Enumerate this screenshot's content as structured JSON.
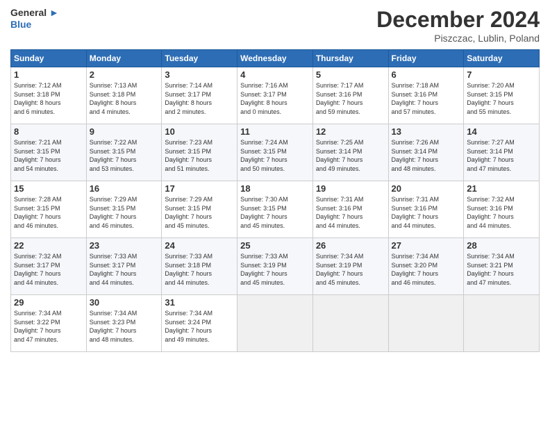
{
  "header": {
    "logo_line1": "General",
    "logo_line2": "Blue",
    "month": "December 2024",
    "location": "Piszczac, Lublin, Poland"
  },
  "weekdays": [
    "Sunday",
    "Monday",
    "Tuesday",
    "Wednesday",
    "Thursday",
    "Friday",
    "Saturday"
  ],
  "weeks": [
    [
      {
        "day": "1",
        "info": "Sunrise: 7:12 AM\nSunset: 3:18 PM\nDaylight: 8 hours\nand 6 minutes."
      },
      {
        "day": "2",
        "info": "Sunrise: 7:13 AM\nSunset: 3:18 PM\nDaylight: 8 hours\nand 4 minutes."
      },
      {
        "day": "3",
        "info": "Sunrise: 7:14 AM\nSunset: 3:17 PM\nDaylight: 8 hours\nand 2 minutes."
      },
      {
        "day": "4",
        "info": "Sunrise: 7:16 AM\nSunset: 3:17 PM\nDaylight: 8 hours\nand 0 minutes."
      },
      {
        "day": "5",
        "info": "Sunrise: 7:17 AM\nSunset: 3:16 PM\nDaylight: 7 hours\nand 59 minutes."
      },
      {
        "day": "6",
        "info": "Sunrise: 7:18 AM\nSunset: 3:16 PM\nDaylight: 7 hours\nand 57 minutes."
      },
      {
        "day": "7",
        "info": "Sunrise: 7:20 AM\nSunset: 3:15 PM\nDaylight: 7 hours\nand 55 minutes."
      }
    ],
    [
      {
        "day": "8",
        "info": "Sunrise: 7:21 AM\nSunset: 3:15 PM\nDaylight: 7 hours\nand 54 minutes."
      },
      {
        "day": "9",
        "info": "Sunrise: 7:22 AM\nSunset: 3:15 PM\nDaylight: 7 hours\nand 53 minutes."
      },
      {
        "day": "10",
        "info": "Sunrise: 7:23 AM\nSunset: 3:15 PM\nDaylight: 7 hours\nand 51 minutes."
      },
      {
        "day": "11",
        "info": "Sunrise: 7:24 AM\nSunset: 3:15 PM\nDaylight: 7 hours\nand 50 minutes."
      },
      {
        "day": "12",
        "info": "Sunrise: 7:25 AM\nSunset: 3:14 PM\nDaylight: 7 hours\nand 49 minutes."
      },
      {
        "day": "13",
        "info": "Sunrise: 7:26 AM\nSunset: 3:14 PM\nDaylight: 7 hours\nand 48 minutes."
      },
      {
        "day": "14",
        "info": "Sunrise: 7:27 AM\nSunset: 3:14 PM\nDaylight: 7 hours\nand 47 minutes."
      }
    ],
    [
      {
        "day": "15",
        "info": "Sunrise: 7:28 AM\nSunset: 3:15 PM\nDaylight: 7 hours\nand 46 minutes."
      },
      {
        "day": "16",
        "info": "Sunrise: 7:29 AM\nSunset: 3:15 PM\nDaylight: 7 hours\nand 46 minutes."
      },
      {
        "day": "17",
        "info": "Sunrise: 7:29 AM\nSunset: 3:15 PM\nDaylight: 7 hours\nand 45 minutes."
      },
      {
        "day": "18",
        "info": "Sunrise: 7:30 AM\nSunset: 3:15 PM\nDaylight: 7 hours\nand 45 minutes."
      },
      {
        "day": "19",
        "info": "Sunrise: 7:31 AM\nSunset: 3:16 PM\nDaylight: 7 hours\nand 44 minutes."
      },
      {
        "day": "20",
        "info": "Sunrise: 7:31 AM\nSunset: 3:16 PM\nDaylight: 7 hours\nand 44 minutes."
      },
      {
        "day": "21",
        "info": "Sunrise: 7:32 AM\nSunset: 3:16 PM\nDaylight: 7 hours\nand 44 minutes."
      }
    ],
    [
      {
        "day": "22",
        "info": "Sunrise: 7:32 AM\nSunset: 3:17 PM\nDaylight: 7 hours\nand 44 minutes."
      },
      {
        "day": "23",
        "info": "Sunrise: 7:33 AM\nSunset: 3:17 PM\nDaylight: 7 hours\nand 44 minutes."
      },
      {
        "day": "24",
        "info": "Sunrise: 7:33 AM\nSunset: 3:18 PM\nDaylight: 7 hours\nand 44 minutes."
      },
      {
        "day": "25",
        "info": "Sunrise: 7:33 AM\nSunset: 3:19 PM\nDaylight: 7 hours\nand 45 minutes."
      },
      {
        "day": "26",
        "info": "Sunrise: 7:34 AM\nSunset: 3:19 PM\nDaylight: 7 hours\nand 45 minutes."
      },
      {
        "day": "27",
        "info": "Sunrise: 7:34 AM\nSunset: 3:20 PM\nDaylight: 7 hours\nand 46 minutes."
      },
      {
        "day": "28",
        "info": "Sunrise: 7:34 AM\nSunset: 3:21 PM\nDaylight: 7 hours\nand 47 minutes."
      }
    ],
    [
      {
        "day": "29",
        "info": "Sunrise: 7:34 AM\nSunset: 3:22 PM\nDaylight: 7 hours\nand 47 minutes."
      },
      {
        "day": "30",
        "info": "Sunrise: 7:34 AM\nSunset: 3:23 PM\nDaylight: 7 hours\nand 48 minutes."
      },
      {
        "day": "31",
        "info": "Sunrise: 7:34 AM\nSunset: 3:24 PM\nDaylight: 7 hours\nand 49 minutes."
      },
      null,
      null,
      null,
      null
    ]
  ]
}
